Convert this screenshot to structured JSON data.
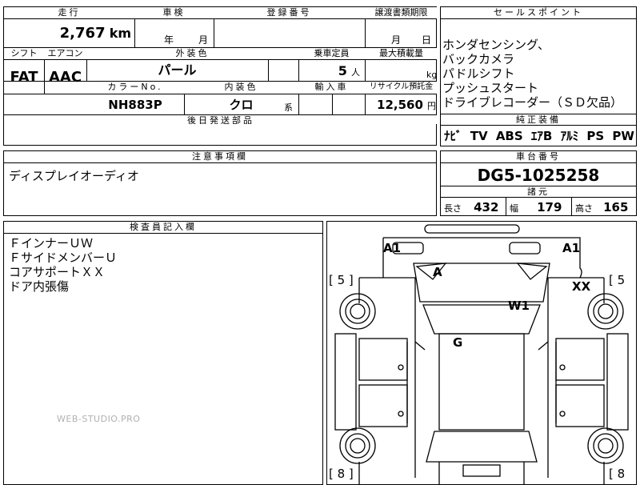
{
  "top": {
    "mileage_label": "走行",
    "mileage_value": "2,767",
    "mileage_unit": "km",
    "inspection_label": "車検",
    "inspection_year_unit": "年",
    "inspection_month_unit": "月",
    "reg_label": "登録番号",
    "transfer_label": "譲渡書類期限",
    "transfer_month_unit": "月",
    "transfer_day_unit": "日"
  },
  "row2": {
    "shift_label": "シフト",
    "aircon_label": "エアコン",
    "exterior_label": "外装色",
    "capacity_label": "乗車定員",
    "maxload_label": "最大積載量",
    "shift_value": "FAT",
    "aircon_value": "AAC",
    "exterior_value": "パール",
    "capacity_value": "5",
    "capacity_unit": "人",
    "maxload_unit": "kg"
  },
  "row3": {
    "color_no_label": "カラーNo.",
    "interior_label": "内装色",
    "import_label": "輸入車",
    "recycle_label": "リサイクル預託金",
    "color_no_value": "NH883P",
    "interior_value": "クロ",
    "interior_unit": "系",
    "recycle_value": "12,560",
    "recycle_unit": "円"
  },
  "later_parts": {
    "label": "後日発送部品"
  },
  "sales": {
    "label": "セールスポイント",
    "items": [
      "ホンダセンシング、",
      "バックカメラ",
      "パドルシフト",
      "プッシュスタート",
      "ドライブレコーダー（ＳＤ欠品）"
    ]
  },
  "equipment": {
    "label": "純正装備",
    "items": [
      "ﾅﾋﾞ",
      "TV",
      "ABS",
      "ｴｱB",
      "ｱﾙﾐ",
      "PS",
      "PW"
    ]
  },
  "notes": {
    "label": "注意事項欄",
    "text": "ディスプレイオーディオ"
  },
  "chassis": {
    "label": "車台番号",
    "value": "DG5-1025258"
  },
  "specs": {
    "label": "諸元",
    "length_label": "長さ",
    "length_value": "432",
    "width_label": "幅",
    "width_value": "179",
    "height_label": "高さ",
    "height_value": "165"
  },
  "inspector": {
    "label": "検査員記入欄",
    "lines": [
      "ＦインナーＵＷ",
      "ＦサイドメンバーＵ",
      "コアサポートＸＸ",
      "ドア内張傷"
    ]
  },
  "diagram": {
    "marks": {
      "a1_left": "A1",
      "a1_right": "A1",
      "a": "A",
      "xx": "XX",
      "w1": "W1",
      "g": "G"
    },
    "bracket_left_top": "[ 5 ]",
    "bracket_right_top": "[ 5",
    "bracket_left_bottom": "[ 8 ]",
    "bracket_right_bottom": "[ 8"
  },
  "watermark": "WEB-STUDIO.PRO"
}
